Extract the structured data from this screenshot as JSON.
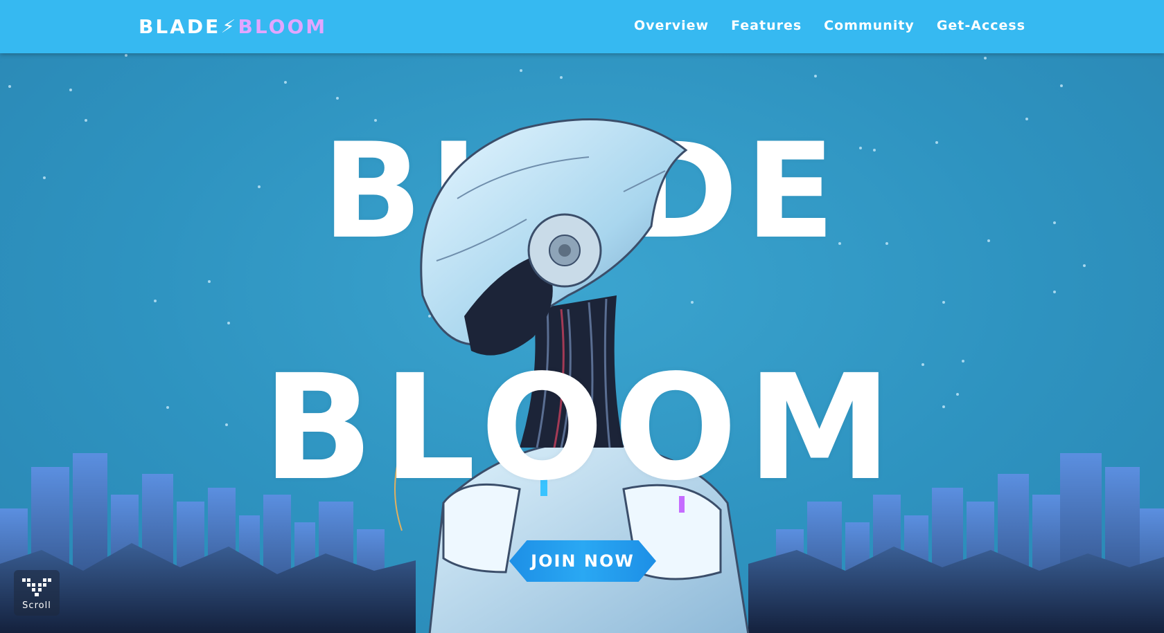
{
  "brand": {
    "part1": "BLADE",
    "bolt": "⚡",
    "part2": "BLOOM"
  },
  "nav": {
    "items": [
      {
        "label": "Overview"
      },
      {
        "label": "Features"
      },
      {
        "label": "Community"
      },
      {
        "label": "Get-Access"
      }
    ]
  },
  "hero": {
    "title_line1": "BLADE",
    "title_line2": "BLOOM",
    "cta_label": "JOIN NOW"
  },
  "scroll": {
    "label": "Scroll",
    "icon": "chevron-down-icon"
  },
  "colors": {
    "navbar": "#36b9f1",
    "background": "#2f97c4",
    "brand_accent": "#e2a6ff",
    "cta": "#1d8fe6",
    "text": "#ffffff"
  }
}
